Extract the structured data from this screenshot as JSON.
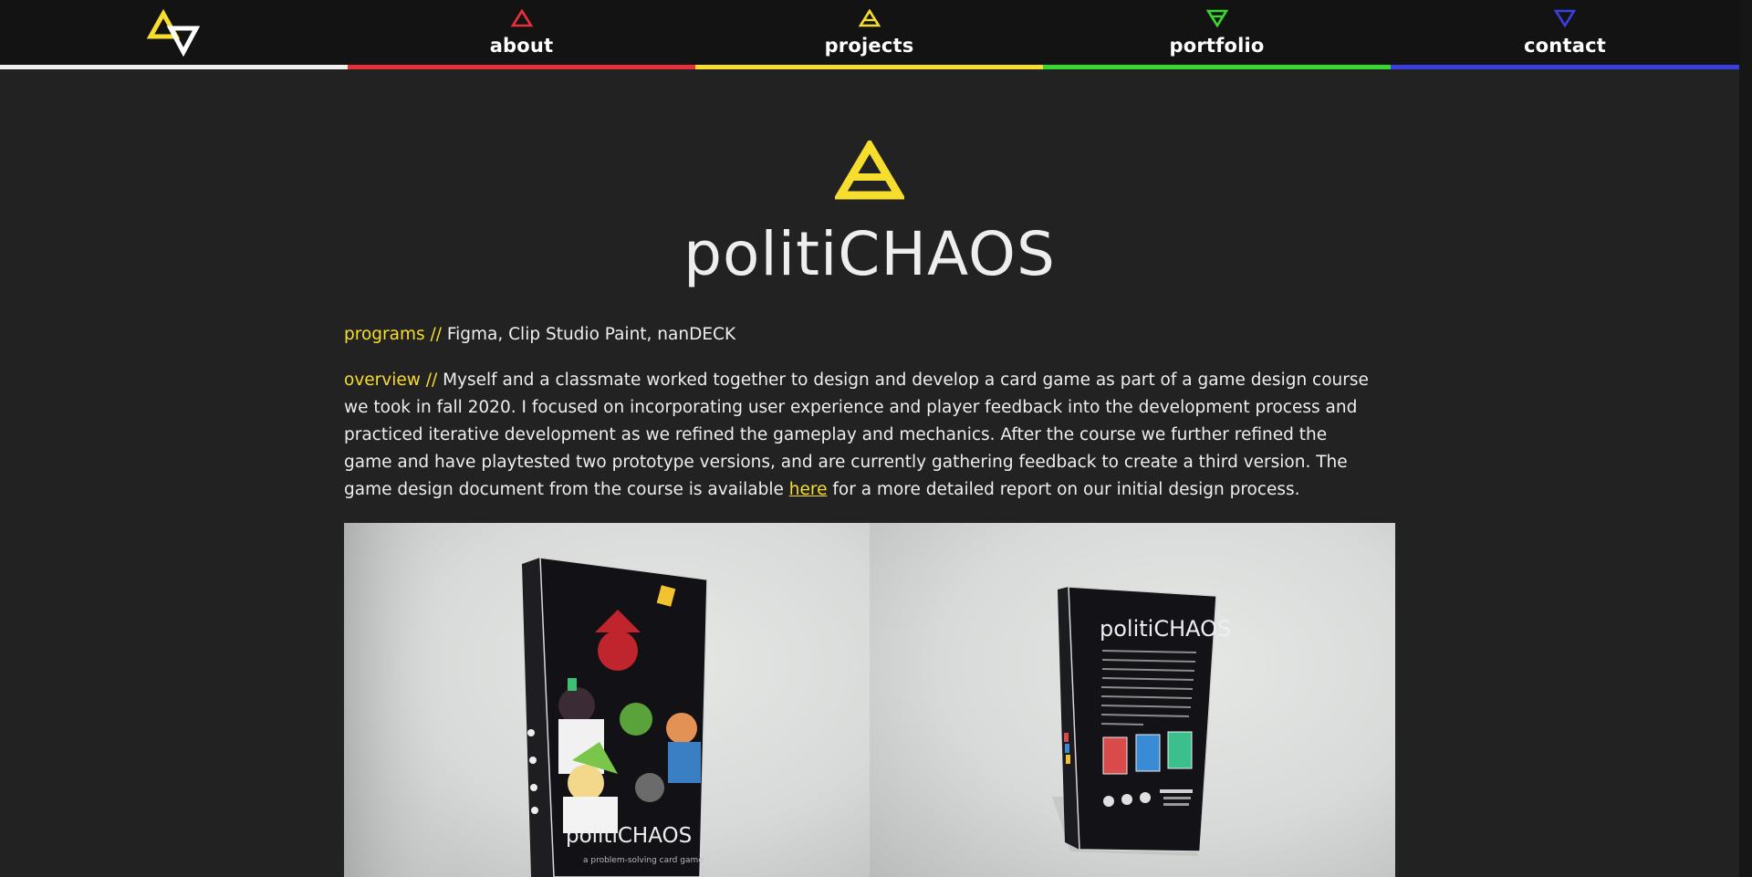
{
  "nav": {
    "logo": "logo-icon",
    "items": [
      {
        "label": "about",
        "icon": "triangle-up-icon",
        "color": "#e8303a"
      },
      {
        "label": "projects",
        "icon": "triangle-a-icon",
        "color": "#f7dd2e"
      },
      {
        "label": "portfolio",
        "icon": "triangle-down-icon",
        "color": "#37d92f"
      },
      {
        "label": "contact",
        "icon": "triangle-down-icon",
        "color": "#3a3fe0"
      }
    ],
    "logo_underline_color": "#ffffff"
  },
  "page": {
    "title": "politiCHAOS",
    "icon": "triangle-a-icon",
    "accent": "#f7dd2e",
    "programs_label": "programs //",
    "programs_value": "Figma, Clip Studio Paint, nanDECK",
    "overview_label": "overview //",
    "overview_text_1": "Myself and a classmate worked together to design and develop a card game as part of a game design course we took in fall 2020. I focused on incorporating user experience and player feedback into the development process and practiced iterative development as we refined the gameplay and mechanics. After the course we further refined the game and have playtested two prototype versions, and are currently gathering feedback to create a third version. The game design document from the course is available",
    "overview_link": "here",
    "overview_text_2": "for a more detailed report on our initial design process."
  },
  "photos": {
    "front": {
      "brand": "politiCHAOS",
      "tagline": "a problem-solving card game"
    },
    "back": {
      "brand": "politiCHAOS"
    }
  }
}
